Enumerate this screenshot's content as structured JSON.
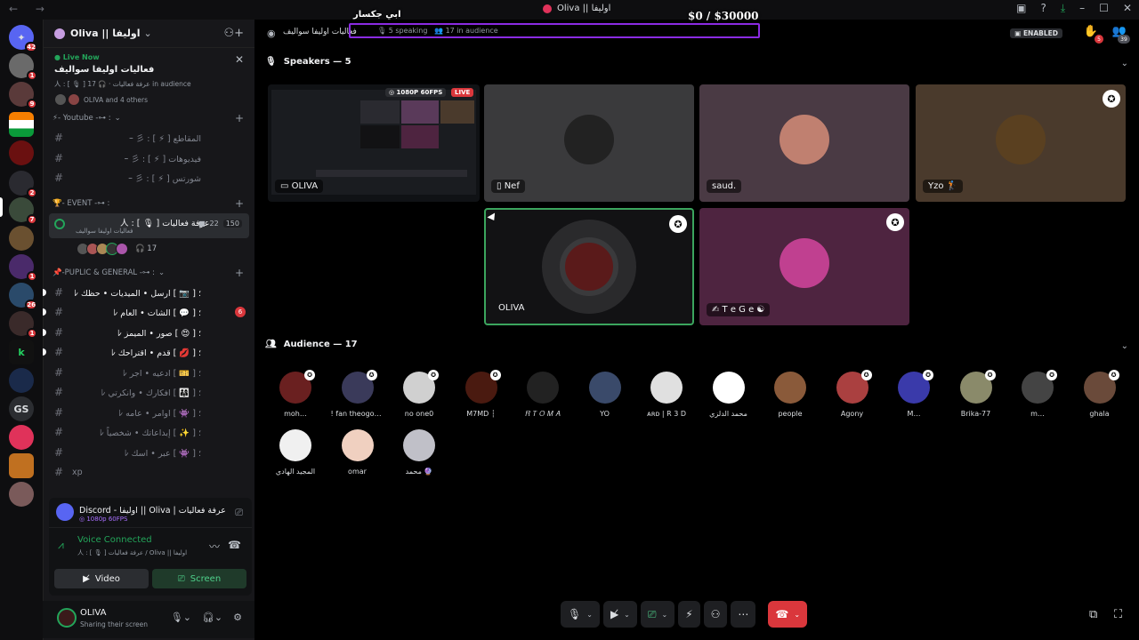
{
  "titlebar": {
    "title": "Oliva || اوليفا",
    "nav_arrows": "← →"
  },
  "overlay": {
    "streamer_name": "ابي جكسار",
    "money": "$0  / $30000"
  },
  "guilds": [
    {
      "name": "discord-home",
      "badge": "42"
    },
    {
      "name": "server-1",
      "badge": "1"
    },
    {
      "name": "server-2",
      "badge": "9"
    },
    {
      "name": "server-3",
      "badge": ""
    },
    {
      "name": "server-4",
      "badge": ""
    },
    {
      "name": "server-5",
      "badge": "2"
    },
    {
      "name": "server-6",
      "badge": "7"
    },
    {
      "name": "server-7",
      "badge": ""
    },
    {
      "name": "server-8",
      "badge": "1"
    },
    {
      "name": "server-9",
      "badge": "26"
    },
    {
      "name": "server-10",
      "badge": "1"
    },
    {
      "name": "server-11",
      "badge": ""
    },
    {
      "name": "server-12",
      "badge": ""
    },
    {
      "name": "server-gs",
      "badge": "",
      "label": "GS"
    },
    {
      "name": "server-14",
      "badge": ""
    },
    {
      "name": "server-15",
      "badge": ""
    },
    {
      "name": "server-16",
      "badge": ""
    }
  ],
  "server": {
    "name": "Oliva || اوليفا",
    "live": {
      "tag": "Live Now",
      "title": "فعاليات اوليفا سواليف",
      "meta": "人 : [ 🎙 ] عرفة فعاليات",
      "audience": "17 in audience",
      "who": "OLIVA and 4 others"
    },
    "categories": {
      "youtube": "- Youtube -⊶ :",
      "event": "- EVENT -⊶ :",
      "public": "-PUPLIC & GENERAL -⊶ :"
    },
    "youtube_channels": [
      "ｰ 彡 : [ ⚡ ] المقاطع",
      "ｰ 彡 : [ ⚡ ] فيديوهات",
      "ｰ 彡 : [ ⚡ ] شورتس"
    ],
    "stage": {
      "name": "人 : [ 🎙 ] عرفة فعاليات",
      "sub": "فعاليات اوليفا سواليف",
      "count_a": "22",
      "count_b": "150",
      "listeners": "17"
    },
    "public_channels": [
      {
        "name": "ﾚ ؛ [ 📷 ] ارسل • الميديات • حظك",
        "unread": true,
        "badge": ""
      },
      {
        "name": "ﾚ ؛ [ 💬 ] الشات • العام",
        "unread": true,
        "badge": "6"
      },
      {
        "name": "ﾚ ؛ [ 😍 ] صور • الميمز",
        "unread": true,
        "badge": ""
      },
      {
        "name": "ﾚ ؛ [ 💋 ] قدم • اقتراحك",
        "unread": true,
        "badge": ""
      },
      {
        "name": "ﾚ ؛ [ 🎫 ] ادعيه • اجر",
        "unread": false,
        "badge": ""
      },
      {
        "name": "ﾚ ؛ [ 👨‍👩‍👧 ] افكارك • وانكرتي",
        "unread": false,
        "badge": ""
      },
      {
        "name": "ﾚ ؛ [ 👾 ] اوامر • عامه",
        "unread": false,
        "badge": ""
      },
      {
        "name": "ﾚ ؛ [ ✨ ] إبداعاتك • شخصياً",
        "unread": false,
        "badge": ""
      },
      {
        "name": "ﾚ ؛ [ 👾 ] عبر • اسك",
        "unread": false,
        "badge": ""
      },
      {
        "name": "xp",
        "unread": false,
        "badge": ""
      }
    ]
  },
  "stream_panel": {
    "title": "Discord - اوليفا || Oliva | عرفة فعاليات [ 🎙 ] : 人",
    "quality": "1080p 60FPS"
  },
  "voice": {
    "status": "Voice Connected",
    "sub": "人 : [ 🎙 ] عرفة فعاليات / Oliva || اوليفا",
    "video_label": "Video",
    "screen_label": "Screen"
  },
  "user": {
    "name": "OLIVA",
    "status": "Sharing their screen"
  },
  "stage_header": {
    "name": "فعاليات اوليفا سواليف",
    "speaking": "5 speaking",
    "audience": "17 in audience",
    "enabled": "ENABLED",
    "hand_badge": "5",
    "people_badge": "39"
  },
  "speakers": {
    "heading": "Speakers — 5",
    "stream": {
      "quality": "1080P 60FPS",
      "live": "LIVE",
      "name": "OLIVA"
    },
    "tiles": [
      {
        "name": "Nef",
        "bg": "#3a3a3c"
      },
      {
        "name": "saud.",
        "bg": "#4a3a44"
      },
      {
        "name": "Yzo 🏌",
        "bg": "#4a3a2c"
      },
      {
        "name": "OLIVA",
        "bg": "#121214"
      },
      {
        "name": "✍ T e G e ☯",
        "bg": "#4e2440"
      }
    ]
  },
  "audience": {
    "heading": "Audience — 17",
    "members": [
      "moh…",
      "! fan theogofli…",
      "no one0",
      "M7MD ┆",
      "𝑅 𝑇 𝑂 𝑀 𝐴",
      "YO",
      "ᴀʀᴅ | R 3 D",
      "محمد الدلزي",
      "people",
      "Agony",
      "M…",
      "Brika-77",
      "m…",
      "ghala",
      "المجيد الهادي",
      "omar",
      "محمد 🔮"
    ]
  },
  "colors": {
    "accent_green": "#23a55a",
    "danger": "#da373c",
    "blurple": "#5865f2",
    "frame_purple": "#8a2be2"
  }
}
